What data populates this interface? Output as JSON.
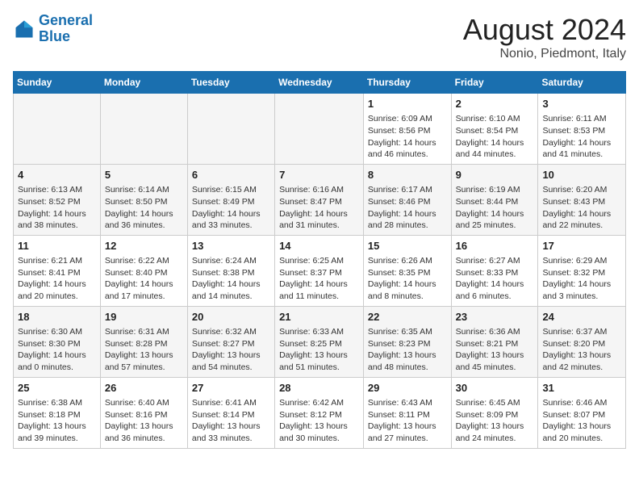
{
  "logo": {
    "line1": "General",
    "line2": "Blue"
  },
  "title": "August 2024",
  "location": "Nonio, Piedmont, Italy",
  "days_of_week": [
    "Sunday",
    "Monday",
    "Tuesday",
    "Wednesday",
    "Thursday",
    "Friday",
    "Saturday"
  ],
  "weeks": [
    [
      {
        "num": "",
        "info": ""
      },
      {
        "num": "",
        "info": ""
      },
      {
        "num": "",
        "info": ""
      },
      {
        "num": "",
        "info": ""
      },
      {
        "num": "1",
        "info": "Sunrise: 6:09 AM\nSunset: 8:56 PM\nDaylight: 14 hours and 46 minutes."
      },
      {
        "num": "2",
        "info": "Sunrise: 6:10 AM\nSunset: 8:54 PM\nDaylight: 14 hours and 44 minutes."
      },
      {
        "num": "3",
        "info": "Sunrise: 6:11 AM\nSunset: 8:53 PM\nDaylight: 14 hours and 41 minutes."
      }
    ],
    [
      {
        "num": "4",
        "info": "Sunrise: 6:13 AM\nSunset: 8:52 PM\nDaylight: 14 hours and 38 minutes."
      },
      {
        "num": "5",
        "info": "Sunrise: 6:14 AM\nSunset: 8:50 PM\nDaylight: 14 hours and 36 minutes."
      },
      {
        "num": "6",
        "info": "Sunrise: 6:15 AM\nSunset: 8:49 PM\nDaylight: 14 hours and 33 minutes."
      },
      {
        "num": "7",
        "info": "Sunrise: 6:16 AM\nSunset: 8:47 PM\nDaylight: 14 hours and 31 minutes."
      },
      {
        "num": "8",
        "info": "Sunrise: 6:17 AM\nSunset: 8:46 PM\nDaylight: 14 hours and 28 minutes."
      },
      {
        "num": "9",
        "info": "Sunrise: 6:19 AM\nSunset: 8:44 PM\nDaylight: 14 hours and 25 minutes."
      },
      {
        "num": "10",
        "info": "Sunrise: 6:20 AM\nSunset: 8:43 PM\nDaylight: 14 hours and 22 minutes."
      }
    ],
    [
      {
        "num": "11",
        "info": "Sunrise: 6:21 AM\nSunset: 8:41 PM\nDaylight: 14 hours and 20 minutes."
      },
      {
        "num": "12",
        "info": "Sunrise: 6:22 AM\nSunset: 8:40 PM\nDaylight: 14 hours and 17 minutes."
      },
      {
        "num": "13",
        "info": "Sunrise: 6:24 AM\nSunset: 8:38 PM\nDaylight: 14 hours and 14 minutes."
      },
      {
        "num": "14",
        "info": "Sunrise: 6:25 AM\nSunset: 8:37 PM\nDaylight: 14 hours and 11 minutes."
      },
      {
        "num": "15",
        "info": "Sunrise: 6:26 AM\nSunset: 8:35 PM\nDaylight: 14 hours and 8 minutes."
      },
      {
        "num": "16",
        "info": "Sunrise: 6:27 AM\nSunset: 8:33 PM\nDaylight: 14 hours and 6 minutes."
      },
      {
        "num": "17",
        "info": "Sunrise: 6:29 AM\nSunset: 8:32 PM\nDaylight: 14 hours and 3 minutes."
      }
    ],
    [
      {
        "num": "18",
        "info": "Sunrise: 6:30 AM\nSunset: 8:30 PM\nDaylight: 14 hours and 0 minutes."
      },
      {
        "num": "19",
        "info": "Sunrise: 6:31 AM\nSunset: 8:28 PM\nDaylight: 13 hours and 57 minutes."
      },
      {
        "num": "20",
        "info": "Sunrise: 6:32 AM\nSunset: 8:27 PM\nDaylight: 13 hours and 54 minutes."
      },
      {
        "num": "21",
        "info": "Sunrise: 6:33 AM\nSunset: 8:25 PM\nDaylight: 13 hours and 51 minutes."
      },
      {
        "num": "22",
        "info": "Sunrise: 6:35 AM\nSunset: 8:23 PM\nDaylight: 13 hours and 48 minutes."
      },
      {
        "num": "23",
        "info": "Sunrise: 6:36 AM\nSunset: 8:21 PM\nDaylight: 13 hours and 45 minutes."
      },
      {
        "num": "24",
        "info": "Sunrise: 6:37 AM\nSunset: 8:20 PM\nDaylight: 13 hours and 42 minutes."
      }
    ],
    [
      {
        "num": "25",
        "info": "Sunrise: 6:38 AM\nSunset: 8:18 PM\nDaylight: 13 hours and 39 minutes."
      },
      {
        "num": "26",
        "info": "Sunrise: 6:40 AM\nSunset: 8:16 PM\nDaylight: 13 hours and 36 minutes."
      },
      {
        "num": "27",
        "info": "Sunrise: 6:41 AM\nSunset: 8:14 PM\nDaylight: 13 hours and 33 minutes."
      },
      {
        "num": "28",
        "info": "Sunrise: 6:42 AM\nSunset: 8:12 PM\nDaylight: 13 hours and 30 minutes."
      },
      {
        "num": "29",
        "info": "Sunrise: 6:43 AM\nSunset: 8:11 PM\nDaylight: 13 hours and 27 minutes."
      },
      {
        "num": "30",
        "info": "Sunrise: 6:45 AM\nSunset: 8:09 PM\nDaylight: 13 hours and 24 minutes."
      },
      {
        "num": "31",
        "info": "Sunrise: 6:46 AM\nSunset: 8:07 PM\nDaylight: 13 hours and 20 minutes."
      }
    ]
  ]
}
